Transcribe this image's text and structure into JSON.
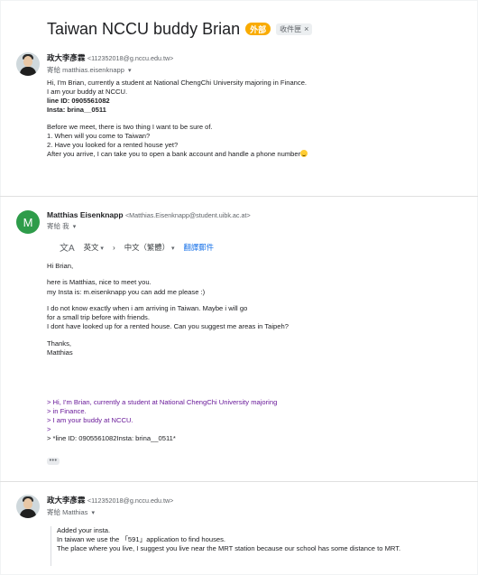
{
  "thread": {
    "subject": "Taiwan NCCU buddy Brian",
    "badge_external": "外部",
    "badge_inbox": "收件匣",
    "badge_inbox_close": "×"
  },
  "messages": [
    {
      "sender_name": "政大李彥霖",
      "sender_email": "<112352018@g.nccu.edu.tw>",
      "to": "寄給 matthias.eisenknapp",
      "chevron": "▾",
      "lines": [
        "Hi, I'm Brian, currently a student at National ChengChi University majoring in Finance.",
        "I am your buddy at NCCU.",
        "line ID: 0905561082",
        "Insta: brina__0511",
        "",
        "Before we meet, there is two thing I want to be sure of.",
        "1. When will you come to Taiwan?",
        "2. Have you looked for a rented house yet?",
        "After you arrive, I can take you to open a bank account and handle a phone number"
      ]
    },
    {
      "avatar_letter": "M",
      "sender_name": "Matthias Eisenknapp",
      "sender_email": "<Matthias.Eisenknapp@student.uibk.ac.at>",
      "to": "寄給 我",
      "chevron": "▾",
      "translate": {
        "icon": "文A",
        "from": "英文",
        "arrow": "›",
        "to": "中文（繁體）",
        "action": "翻譯郵件",
        "caret": "▾"
      },
      "lines": [
        "Hi Brian,",
        "",
        "here is Matthias, nice to meet you.",
        "my Insta is: m.eisenknapp you can add me please :)",
        "",
        "I do not know exactly when i am arriving in Taiwan. Maybe i will go",
        "for a small trip before with friends.",
        "I dont have looked up for a rented house. Can you suggest me areas in Taipeh?",
        "",
        "Thanks,",
        "Matthias"
      ],
      "quoted": [
        "> Hi, I'm Brian, currently a student at National ChengChi University majoring",
        "> in Finance.",
        "> I am your buddy at NCCU.",
        ">",
        "> *line ID: 0905561082Insta: brina__0511*"
      ],
      "show_trimmed": "•••"
    },
    {
      "sender_name": "政大李彥霖",
      "sender_email": "<112352018@g.nccu.edu.tw>",
      "to": "寄給 Matthias",
      "chevron": "▾",
      "lines": [
        "Added your insta.",
        "In taiwan we use the 「591」application to find houses.",
        "The place where you live, I suggest you live near the MRT station because our school has some distance to MRT."
      ]
    }
  ]
}
